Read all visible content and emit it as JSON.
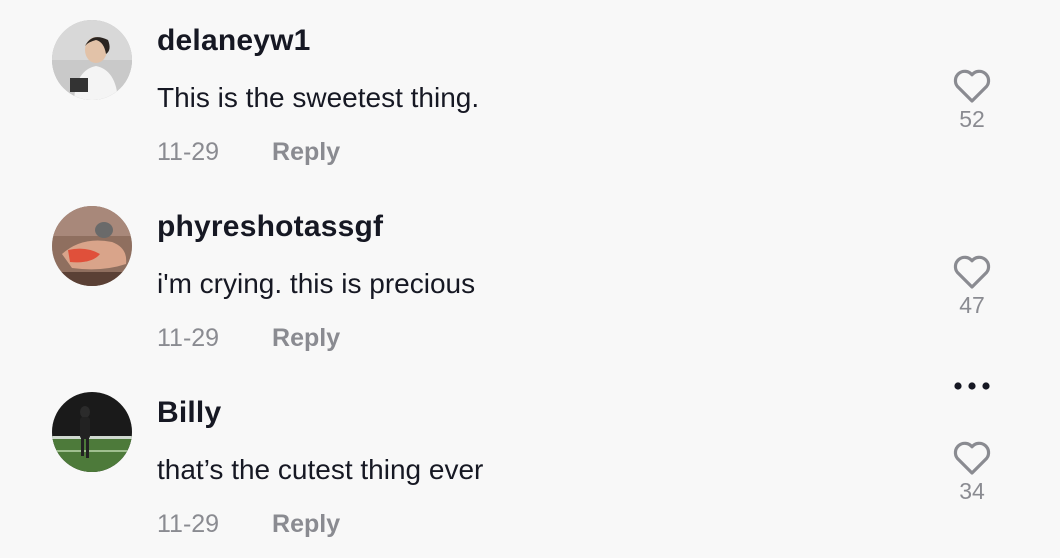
{
  "comments": [
    {
      "username": "delaneyw1",
      "text": "This is the sweetest thing.",
      "date": "11-29",
      "reply_label": "Reply",
      "likes": "52",
      "avatar_icon": "user-photo-avatar"
    },
    {
      "username": "phyreshotassgf",
      "text": "i'm crying. this is precious",
      "date": "11-29",
      "reply_label": "Reply",
      "likes": "47",
      "avatar_icon": "user-photo-avatar"
    },
    {
      "username": "Billy",
      "text": "that’s the cutest thing ever",
      "date": "11-29",
      "reply_label": "Reply",
      "likes": "34",
      "avatar_icon": "user-photo-avatar"
    }
  ],
  "icons": {
    "like": "heart-outline-icon",
    "more": "more-options-icon"
  },
  "colors": {
    "background": "#f8f8f8",
    "text": "#161823",
    "secondary": "#8a8b91"
  }
}
